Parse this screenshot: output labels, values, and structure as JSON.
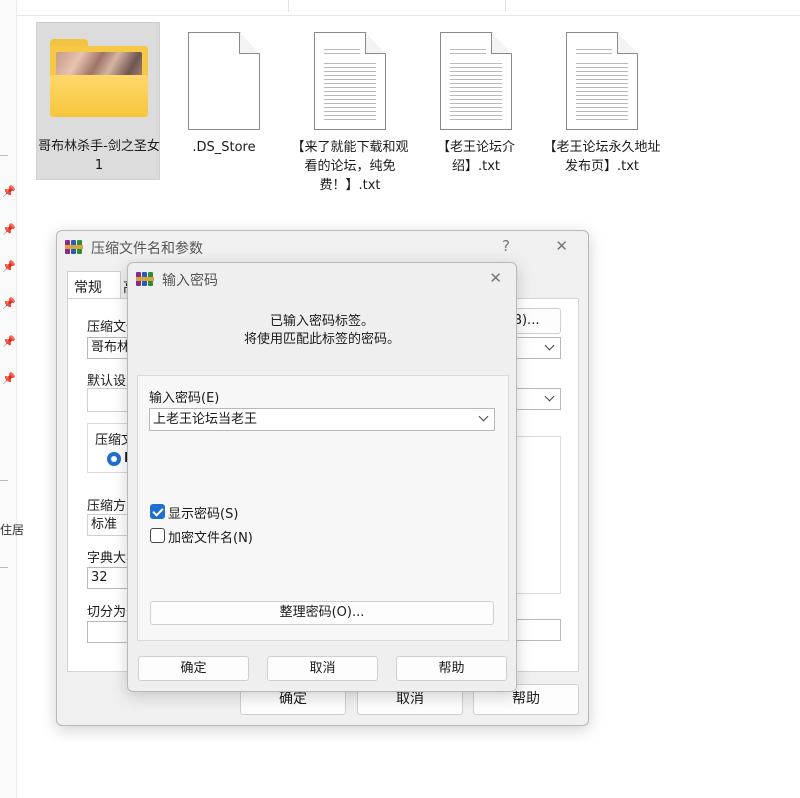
{
  "explorer": {
    "left_text": "住居",
    "files": [
      {
        "name": "哥布林杀手-剑之圣女1"
      },
      {
        "name": ".DS_Store"
      },
      {
        "name": "【来了就能下载和观看的论坛，纯免费！】.txt"
      },
      {
        "name": "【老王论坛介绍】.txt"
      },
      {
        "name": "【老王论坛永久地址发布页】.txt"
      }
    ]
  },
  "compress_dialog": {
    "title": "压缩文件名和参数",
    "help_glyph": "?",
    "close_glyph": "✕",
    "tab_general": "常规",
    "tab_advanced_partial": "高",
    "archive_name_label": "压缩文件",
    "archive_name_value": "哥布林",
    "browse_button": "(B)...",
    "default_profile_label": "默认设置",
    "format_label": "压缩文",
    "format_radio_partial": "R",
    "method_label": "压缩方",
    "method_value": "标准",
    "dict_label": "字典大小",
    "dict_value": "32",
    "split_label": "切分为分",
    "ok_button": "确定",
    "cancel_button": "取消",
    "help_button": "帮助"
  },
  "password_dialog": {
    "title": "输入密码",
    "close_glyph": "✕",
    "info_line1": "已输入密码标签。",
    "info_line2": "将使用匹配此标签的密码。",
    "password_label": "输入密码(E)",
    "password_value": "上老王论坛当老王",
    "show_password_label": "显示密码(S)",
    "show_password_checked": true,
    "encrypt_names_label": "加密文件名(N)",
    "encrypt_names_checked": false,
    "organize_button": "整理密码(O)...",
    "ok_button": "确定",
    "cancel_button": "取消",
    "help_button": "帮助"
  }
}
